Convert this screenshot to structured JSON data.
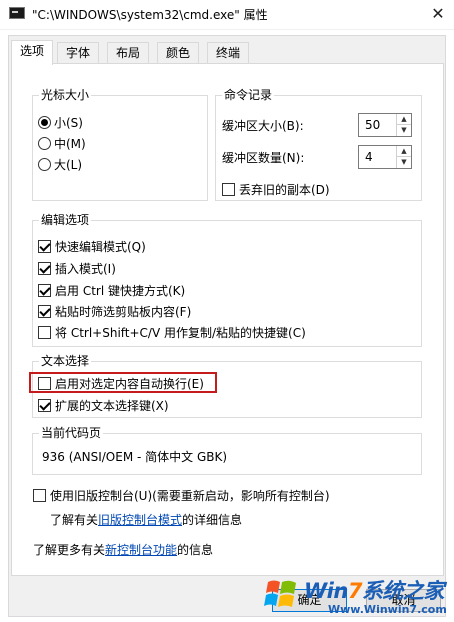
{
  "window": {
    "title": "\"C:\\WINDOWS\\system32\\cmd.exe\" 属性",
    "app_icon": "console-icon",
    "close_glyph": "✕"
  },
  "tabs": [
    {
      "label": "选项",
      "active": true
    },
    {
      "label": "字体",
      "active": false
    },
    {
      "label": "布局",
      "active": false
    },
    {
      "label": "颜色",
      "active": false
    },
    {
      "label": "终端",
      "active": false
    }
  ],
  "cursor_size": {
    "legend": "光标大小",
    "options": [
      {
        "label": "小(S)",
        "selected": true
      },
      {
        "label": "中(M)",
        "selected": false
      },
      {
        "label": "大(L)",
        "selected": false
      }
    ]
  },
  "command_history": {
    "legend": "命令记录",
    "buffer_size_label": "缓冲区大小(B):",
    "buffer_size_value": "50",
    "buffer_count_label": "缓冲区数量(N):",
    "buffer_count_value": "4",
    "discard_old_label": "丢弃旧的副本(D)",
    "discard_old_checked": false
  },
  "edit_options": {
    "legend": "编辑选项",
    "items": [
      {
        "label": "快速编辑模式(Q)",
        "checked": true
      },
      {
        "label": "插入模式(I)",
        "checked": true
      },
      {
        "label": "启用 Ctrl 键快捷方式(K)",
        "checked": true
      },
      {
        "label": "粘贴时筛选剪贴板内容(F)",
        "checked": true
      },
      {
        "label": "将 Ctrl+Shift+C/V 用作复制/粘贴的快捷键(C)",
        "checked": false
      }
    ]
  },
  "text_selection": {
    "legend": "文本选择",
    "items": [
      {
        "label": "启用对选定内容自动换行(E)",
        "checked": false
      },
      {
        "label": "扩展的文本选择键(X)",
        "checked": true
      }
    ]
  },
  "codepage": {
    "legend": "当前代码页",
    "value": "936   (ANSI/OEM - 简体中文 GBK)"
  },
  "legacy": {
    "checkbox_label": "使用旧版控制台(U)(需要重新启动，影响所有控制台)",
    "checked": false,
    "learn_prefix": "了解有关",
    "learn_link": "旧版控制台模式",
    "learn_suffix": "的详细信息"
  },
  "more_info": {
    "prefix": "了解更多有关",
    "link": "新控制台功能",
    "suffix": "的信息"
  },
  "buttons": {
    "ok": "确定",
    "cancel": "取消"
  },
  "watermark": {
    "line1_a": "Win",
    "line1_b": "7",
    "line1_c": "系统之家",
    "line2": "Www.Winwin7.com"
  },
  "colors": {
    "link": "#0047b3",
    "highlight_box": "#c71b1b",
    "watermark_blue": "#1b5eb6",
    "watermark_orange": "#ff7a00"
  }
}
